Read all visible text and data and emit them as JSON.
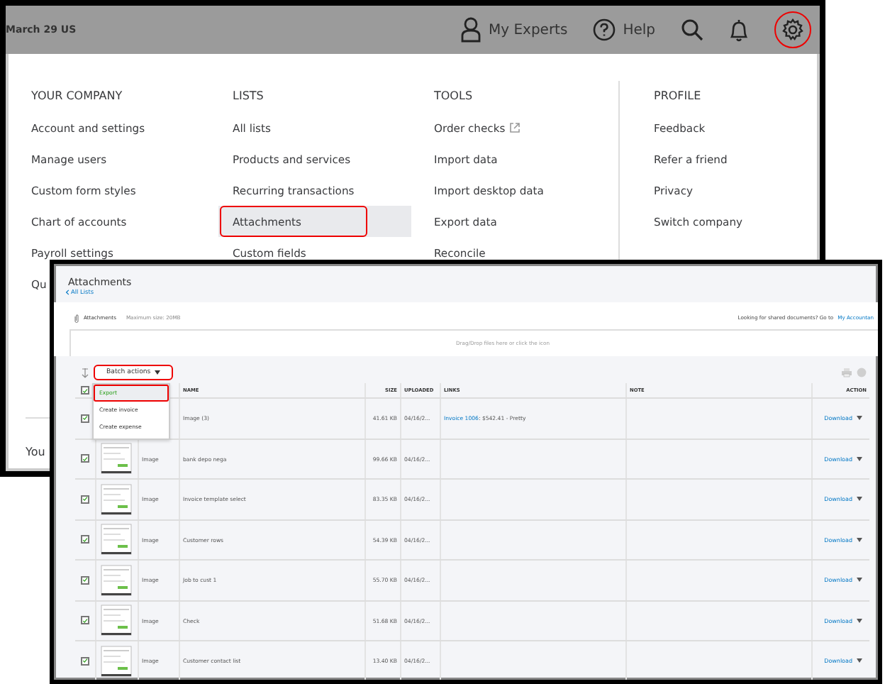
{
  "back_window": {
    "account": "March 29 US",
    "top_bar": {
      "experts": "My Experts",
      "help": "Help",
      "settings_annotated": true
    },
    "menu_columns": [
      {
        "heading": "YOUR COMPANY",
        "items": [
          {
            "label": "Account and settings",
            "selected": false,
            "annotated": false,
            "external": false
          },
          {
            "label": "Manage users",
            "selected": false,
            "annotated": false,
            "external": false
          },
          {
            "label": "Custom form styles",
            "selected": false,
            "annotated": false,
            "external": false
          },
          {
            "label": "Chart of accounts",
            "selected": false,
            "annotated": false,
            "external": false
          },
          {
            "label": "Payroll settings",
            "selected": false,
            "annotated": false,
            "external": false
          },
          {
            "label": "Qu",
            "selected": false,
            "annotated": false,
            "external": false
          }
        ]
      },
      {
        "heading": "LISTS",
        "items": [
          {
            "label": "All lists",
            "selected": false,
            "annotated": false,
            "external": false
          },
          {
            "label": "Products and services",
            "selected": false,
            "annotated": false,
            "external": false
          },
          {
            "label": "Recurring transactions",
            "selected": false,
            "annotated": false,
            "external": false
          },
          {
            "label": "Attachments",
            "selected": true,
            "annotated": true,
            "external": false
          },
          {
            "label": "Custom fields",
            "selected": false,
            "annotated": false,
            "external": false
          }
        ]
      },
      {
        "heading": "TOOLS",
        "items": [
          {
            "label": "Order checks",
            "selected": false,
            "annotated": false,
            "external": true
          },
          {
            "label": "Import data",
            "selected": false,
            "annotated": false,
            "external": false
          },
          {
            "label": "Import desktop data",
            "selected": false,
            "annotated": false,
            "external": false
          },
          {
            "label": "Export data",
            "selected": false,
            "annotated": false,
            "external": false
          },
          {
            "label": "Reconcile",
            "selected": false,
            "annotated": false,
            "external": false
          }
        ]
      },
      {
        "heading": "PROFILE",
        "items": [
          {
            "label": "Feedback",
            "selected": false,
            "annotated": false,
            "external": false
          },
          {
            "label": "Refer a friend",
            "selected": false,
            "annotated": false,
            "external": false
          },
          {
            "label": "Privacy",
            "selected": false,
            "annotated": false,
            "external": false
          },
          {
            "label": "Switch company",
            "selected": false,
            "annotated": false,
            "external": false
          }
        ]
      }
    ],
    "footer": "You"
  },
  "front_window": {
    "title": "Attachments",
    "back_link": "All Lists",
    "upload": {
      "label": "Attachments",
      "max_size": "Maximum size: 20MB",
      "shared_prompt": "Looking for shared documents? Go to",
      "shared_link": "My Accountan",
      "dropzone": "Drag/Drop files here or click the icon"
    },
    "batch": {
      "label": "Batch actions",
      "annotated": true,
      "menu": [
        {
          "label": "Export",
          "selected": true,
          "annotated": true
        },
        {
          "label": "Create invoice",
          "selected": false,
          "annotated": false
        },
        {
          "label": "Create expense",
          "selected": false,
          "annotated": false
        }
      ]
    },
    "table": {
      "header_checked": true,
      "columns": [
        "NAME",
        "SIZE",
        "UPLOADED",
        "LINKS",
        "NOTE",
        "ACTION"
      ],
      "rows": [
        {
          "checked": true,
          "name": "Image (3)",
          "size": "41.61 KB",
          "uploaded": "04/16/2...",
          "link": "Invoice 1006",
          "link_note": ": $542.41 - Pretty",
          "action": "Download"
        },
        {
          "checked": true,
          "type": "Image",
          "name": "bank depo nega",
          "size": "99.66 KB",
          "uploaded": "04/16/2...",
          "action": "Download"
        },
        {
          "checked": true,
          "type": "Image",
          "name": "Invoice template select",
          "size": "83.35 KB",
          "uploaded": "04/16/2...",
          "action": "Download"
        },
        {
          "checked": true,
          "type": "Image",
          "name": "Customer rows",
          "size": "54.39 KB",
          "uploaded": "04/16/2...",
          "action": "Download"
        },
        {
          "checked": true,
          "type": "Image",
          "name": "Job to cust 1",
          "size": "55.70 KB",
          "uploaded": "04/16/2...",
          "action": "Download"
        },
        {
          "checked": true,
          "type": "Image",
          "name": "Check",
          "size": "51.68 KB",
          "uploaded": "04/16/2...",
          "action": "Download"
        },
        {
          "checked": true,
          "type": "Image",
          "name": "Customer contact list",
          "size": "13.40 KB",
          "uploaded": "04/16/2...",
          "action": "Download"
        }
      ]
    }
  }
}
